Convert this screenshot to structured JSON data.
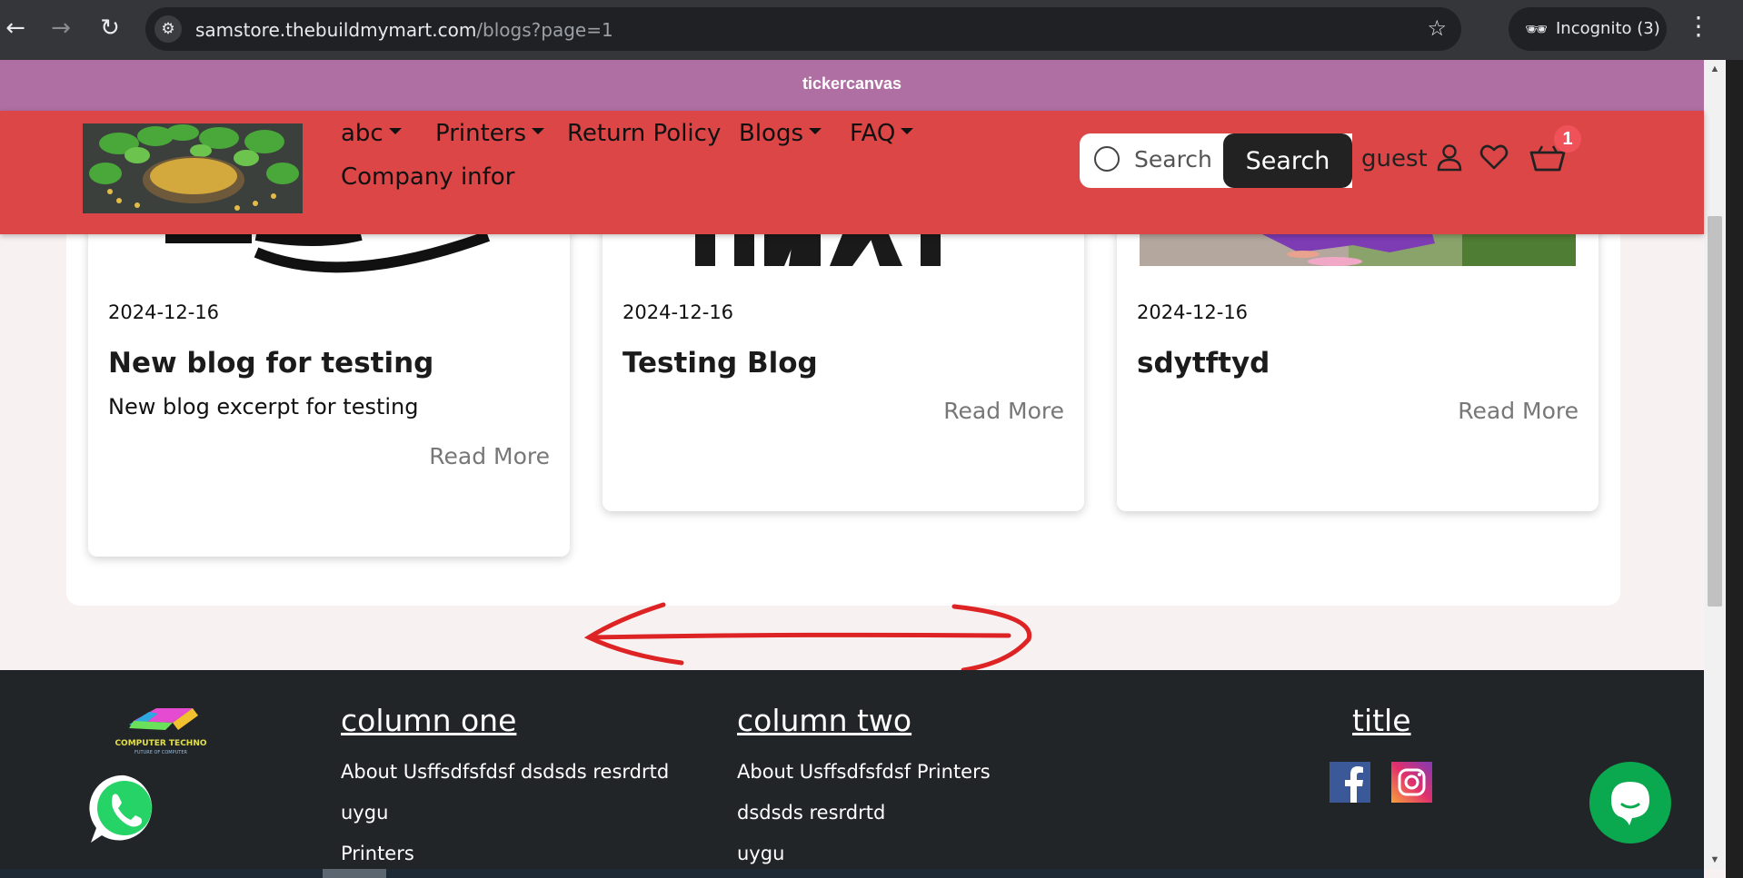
{
  "browser": {
    "url_host": "samstore.thebuildmymart.com",
    "url_path": "/blogs?page=1",
    "incognito_label": "Incognito (3)"
  },
  "ticker": {
    "text": "tickercanvas"
  },
  "header": {
    "nav": [
      {
        "label": "abc",
        "dropdown": true
      },
      {
        "label": "Printers",
        "dropdown": true
      },
      {
        "label": "Return Policy",
        "dropdown": false
      },
      {
        "label": "Blogs",
        "dropdown": true
      },
      {
        "label": "FAQ",
        "dropdown": true
      },
      {
        "label": "Company infor",
        "dropdown": false
      }
    ],
    "search_placeholder": "Search",
    "search_button": "Search",
    "user_label": "guest",
    "cart_count": "1"
  },
  "blogs": [
    {
      "date": "2024-12-16",
      "title": "New blog for testing",
      "excerpt": "New blog excerpt for testing",
      "read_more": "Read More"
    },
    {
      "date": "2024-12-16",
      "title": "Testing Blog",
      "excerpt": "",
      "read_more": "Read More"
    },
    {
      "date": "2024-12-16",
      "title": "sdytftyd",
      "excerpt": "",
      "read_more": "Read More"
    }
  ],
  "footer": {
    "logo_text": "COMPUTER TECHNO",
    "logo_tagline": "FUTURE OF COMPUTER",
    "column_one": {
      "heading": "column one",
      "links": [
        "About Usffsdfsfdsf dsdsds resrdrtd",
        "uygu",
        "Printers"
      ]
    },
    "column_two": {
      "heading": "column two",
      "links": [
        "About Usffsdfsfdsf  Printers",
        "dsdsds resrdrtd",
        "uygu"
      ]
    },
    "column_three": {
      "heading": "title"
    }
  },
  "colors": {
    "ticker": "#b06fa3",
    "header": "#dc4646",
    "footer": "#222528",
    "chat": "#0aa84f",
    "badge": "#f0525a"
  }
}
